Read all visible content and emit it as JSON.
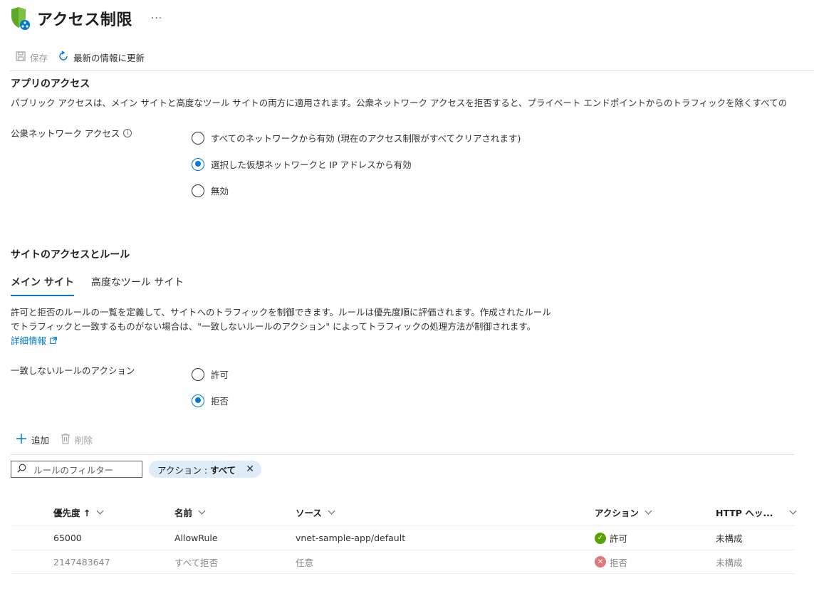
{
  "header": {
    "title": "アクセス制限",
    "more": "···"
  },
  "toolbar": {
    "save": "保存",
    "refresh": "最新の情報に更新"
  },
  "app_access": {
    "title": "アプリのアクセス",
    "description": "パブリック アクセスは、メイン サイトと高度なツール サイトの両方に適用されます。公衆ネットワーク アクセスを拒否すると、プライベート エンドポイントからのトラフィックを除くすべての",
    "public_network_label": "公衆ネットワーク アクセス",
    "options": [
      {
        "label": "すべてのネットワークから有効 (現在のアクセス制限がすべてクリアされます)",
        "checked": false
      },
      {
        "label": "選択した仮想ネットワークと IP アドレスから有効",
        "checked": true
      },
      {
        "label": "無効",
        "checked": false
      }
    ]
  },
  "site_access": {
    "title": "サイトのアクセスとルール",
    "tabs": [
      {
        "label": "メイン サイト",
        "active": true
      },
      {
        "label": "高度なツール サイト",
        "active": false
      }
    ],
    "desc_line1": "許可と拒否のルールの一覧を定義して、サイトへのトラフィックを制御できます。ルールは優先度順に評価されます。作成されたルール",
    "desc_line2": "でトラフィックと一致するものがない場合は、\"一致しないルールのアクション\" によってトラフィックの処理方法が制御されます。",
    "learn_more": "詳細情報",
    "unmatched_label": "一致しないルールのアクション",
    "unmatched_options": [
      {
        "label": "許可",
        "checked": false
      },
      {
        "label": "拒否",
        "checked": true
      }
    ]
  },
  "commands": {
    "add": "追加",
    "delete": "削除"
  },
  "filter": {
    "placeholder": "ルールのフィルター",
    "pill_prefix": "アクション : ",
    "pill_value": "すべて"
  },
  "table": {
    "columns": [
      "優先度 ↑",
      "名前",
      "ソース",
      "アクション",
      "HTTP ヘッ..."
    ],
    "rows": [
      {
        "priority": "65000",
        "name": "AllowRule",
        "source": "vnet-sample-app/default",
        "action": "許可",
        "http": "未構成",
        "status": "allow"
      },
      {
        "priority": "2147483647",
        "name": "すべて拒否",
        "source": "任意",
        "action": "拒否",
        "http": "未構成",
        "status": "deny"
      }
    ]
  },
  "colors": {
    "accent": "#0078d4",
    "allow": "#57a300",
    "deny": "#e0787c"
  }
}
